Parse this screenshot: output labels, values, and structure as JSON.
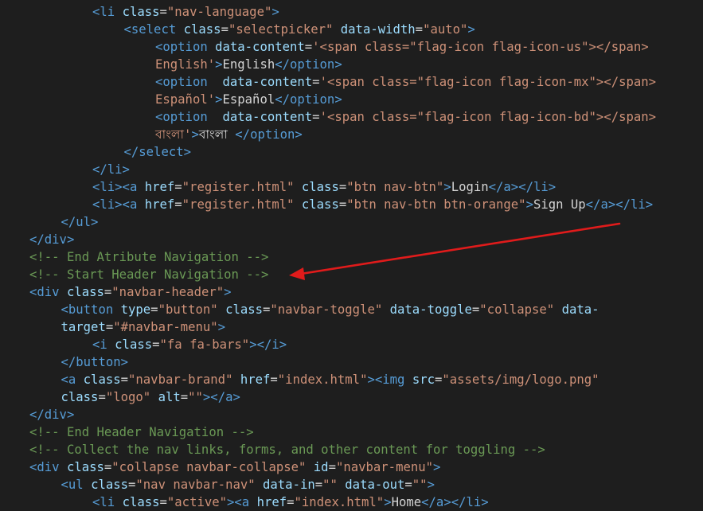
{
  "editor": {
    "lines": [
      {
        "indent": 2,
        "tokens": [
          {
            "t": "tag",
            "v": "<li "
          },
          {
            "t": "attr",
            "v": "class"
          },
          {
            "t": "txt",
            "v": "="
          },
          {
            "t": "str",
            "v": "\"nav-language\""
          },
          {
            "t": "tag",
            "v": ">"
          }
        ]
      },
      {
        "indent": 3,
        "tokens": [
          {
            "t": "tag",
            "v": "<select "
          },
          {
            "t": "attr",
            "v": "class"
          },
          {
            "t": "txt",
            "v": "="
          },
          {
            "t": "str",
            "v": "\"selectpicker\""
          },
          {
            "t": "txt",
            "v": " "
          },
          {
            "t": "attr",
            "v": "data-width"
          },
          {
            "t": "txt",
            "v": "="
          },
          {
            "t": "str",
            "v": "\"auto\""
          },
          {
            "t": "tag",
            "v": ">"
          }
        ]
      },
      {
        "indent": 4,
        "tokens": [
          {
            "t": "tag",
            "v": "<option "
          },
          {
            "t": "attr",
            "v": "data-content"
          },
          {
            "t": "txt",
            "v": "="
          },
          {
            "t": "str",
            "v": "'<span class=\"flag-icon flag-icon-us\"></span>"
          }
        ]
      },
      {
        "indent": 4,
        "tokens": [
          {
            "t": "str",
            "v": "English'"
          },
          {
            "t": "tag",
            "v": ">"
          },
          {
            "t": "txt",
            "v": "English"
          },
          {
            "t": "tag",
            "v": "</option>"
          }
        ]
      },
      {
        "indent": 4,
        "tokens": [
          {
            "t": "tag",
            "v": "<option "
          },
          {
            "t": "txt",
            "v": " "
          },
          {
            "t": "attr",
            "v": "data-content"
          },
          {
            "t": "txt",
            "v": "="
          },
          {
            "t": "str",
            "v": "'<span class=\"flag-icon flag-icon-mx\"></span>"
          }
        ]
      },
      {
        "indent": 4,
        "tokens": [
          {
            "t": "str",
            "v": "Español'"
          },
          {
            "t": "tag",
            "v": ">"
          },
          {
            "t": "txt",
            "v": "Español"
          },
          {
            "t": "tag",
            "v": "</option>"
          }
        ]
      },
      {
        "indent": 4,
        "tokens": [
          {
            "t": "tag",
            "v": "<option "
          },
          {
            "t": "txt",
            "v": " "
          },
          {
            "t": "attr",
            "v": "data-content"
          },
          {
            "t": "txt",
            "v": "="
          },
          {
            "t": "str",
            "v": "'<span class=\"flag-icon flag-icon-bd\"></span>"
          }
        ]
      },
      {
        "indent": 4,
        "tokens": [
          {
            "t": "str",
            "v": "বাংলা'"
          },
          {
            "t": "tag",
            "v": ">"
          },
          {
            "t": "txt",
            "v": "বাংলা "
          },
          {
            "t": "tag",
            "v": "</option>"
          }
        ]
      },
      {
        "indent": 3,
        "tokens": [
          {
            "t": "tag",
            "v": "</select>"
          }
        ]
      },
      {
        "indent": 2,
        "tokens": [
          {
            "t": "tag",
            "v": "</li>"
          }
        ]
      },
      {
        "indent": 2,
        "tokens": [
          {
            "t": "tag",
            "v": "<li><a "
          },
          {
            "t": "attr",
            "v": "href"
          },
          {
            "t": "txt",
            "v": "="
          },
          {
            "t": "str",
            "v": "\"register.html\""
          },
          {
            "t": "txt",
            "v": " "
          },
          {
            "t": "attr",
            "v": "class"
          },
          {
            "t": "txt",
            "v": "="
          },
          {
            "t": "str",
            "v": "\"btn nav-btn\""
          },
          {
            "t": "tag",
            "v": ">"
          },
          {
            "t": "txt",
            "v": "Login"
          },
          {
            "t": "tag",
            "v": "</a></li>"
          }
        ]
      },
      {
        "indent": 2,
        "tokens": [
          {
            "t": "tag",
            "v": "<li><a "
          },
          {
            "t": "attr",
            "v": "href"
          },
          {
            "t": "txt",
            "v": "="
          },
          {
            "t": "str",
            "v": "\"register.html\""
          },
          {
            "t": "txt",
            "v": " "
          },
          {
            "t": "attr",
            "v": "class"
          },
          {
            "t": "txt",
            "v": "="
          },
          {
            "t": "str",
            "v": "\"btn nav-btn btn-orange\""
          },
          {
            "t": "tag",
            "v": ">"
          },
          {
            "t": "txt",
            "v": "Sign Up"
          },
          {
            "t": "tag",
            "v": "</a></li>"
          }
        ]
      },
      {
        "indent": 1,
        "tokens": [
          {
            "t": "tag",
            "v": "</ul>"
          }
        ]
      },
      {
        "indent": 0,
        "tokens": [
          {
            "t": "tag",
            "v": "</div>"
          }
        ]
      },
      {
        "indent": 0,
        "tokens": [
          {
            "t": "cmt",
            "v": "<!-- End Atribute Navigation -->"
          }
        ]
      },
      {
        "indent": 0,
        "tokens": [
          {
            "t": "cmt",
            "v": "<!-- Start Header Navigation -->"
          }
        ]
      },
      {
        "indent": 0,
        "tokens": [
          {
            "t": "tag",
            "v": "<div "
          },
          {
            "t": "attr",
            "v": "class"
          },
          {
            "t": "txt",
            "v": "="
          },
          {
            "t": "str",
            "v": "\"navbar-header\""
          },
          {
            "t": "tag",
            "v": ">"
          }
        ]
      },
      {
        "indent": 1,
        "tokens": [
          {
            "t": "tag",
            "v": "<button "
          },
          {
            "t": "attr",
            "v": "type"
          },
          {
            "t": "txt",
            "v": "="
          },
          {
            "t": "str",
            "v": "\"button\""
          },
          {
            "t": "txt",
            "v": " "
          },
          {
            "t": "attr",
            "v": "class"
          },
          {
            "t": "txt",
            "v": "="
          },
          {
            "t": "str",
            "v": "\"navbar-toggle\""
          },
          {
            "t": "txt",
            "v": " "
          },
          {
            "t": "attr",
            "v": "data-toggle"
          },
          {
            "t": "txt",
            "v": "="
          },
          {
            "t": "str",
            "v": "\"collapse\""
          },
          {
            "t": "txt",
            "v": " "
          },
          {
            "t": "attr",
            "v": "data-"
          }
        ]
      },
      {
        "indent": 1,
        "tokens": [
          {
            "t": "attr",
            "v": "target"
          },
          {
            "t": "txt",
            "v": "="
          },
          {
            "t": "str",
            "v": "\"#navbar-menu\""
          },
          {
            "t": "tag",
            "v": ">"
          }
        ]
      },
      {
        "indent": 2,
        "tokens": [
          {
            "t": "tag",
            "v": "<i "
          },
          {
            "t": "attr",
            "v": "class"
          },
          {
            "t": "txt",
            "v": "="
          },
          {
            "t": "str",
            "v": "\"fa fa-bars\""
          },
          {
            "t": "tag",
            "v": "></i>"
          }
        ]
      },
      {
        "indent": 1,
        "tokens": [
          {
            "t": "tag",
            "v": "</button>"
          }
        ]
      },
      {
        "indent": 1,
        "tokens": [
          {
            "t": "tag",
            "v": "<a "
          },
          {
            "t": "attr",
            "v": "class"
          },
          {
            "t": "txt",
            "v": "="
          },
          {
            "t": "str",
            "v": "\"navbar-brand\""
          },
          {
            "t": "txt",
            "v": " "
          },
          {
            "t": "attr",
            "v": "href"
          },
          {
            "t": "txt",
            "v": "="
          },
          {
            "t": "str",
            "v": "\"index.html\""
          },
          {
            "t": "tag",
            "v": "><img "
          },
          {
            "t": "attr",
            "v": "src"
          },
          {
            "t": "txt",
            "v": "="
          },
          {
            "t": "str",
            "v": "\"assets/img/logo.png\""
          }
        ]
      },
      {
        "indent": 1,
        "tokens": [
          {
            "t": "attr",
            "v": "class"
          },
          {
            "t": "txt",
            "v": "="
          },
          {
            "t": "str",
            "v": "\"logo\""
          },
          {
            "t": "txt",
            "v": " "
          },
          {
            "t": "attr",
            "v": "alt"
          },
          {
            "t": "txt",
            "v": "="
          },
          {
            "t": "str",
            "v": "\"\""
          },
          {
            "t": "tag",
            "v": "></a>"
          }
        ]
      },
      {
        "indent": 0,
        "tokens": [
          {
            "t": "tag",
            "v": "</div>"
          }
        ]
      },
      {
        "indent": 0,
        "tokens": [
          {
            "t": "cmt",
            "v": "<!-- End Header Navigation -->"
          }
        ]
      },
      {
        "indent": 0,
        "tokens": [
          {
            "t": "cmt",
            "v": "<!-- Collect the nav links, forms, and other content for toggling -->"
          }
        ]
      },
      {
        "indent": 0,
        "tokens": [
          {
            "t": "tag",
            "v": "<div "
          },
          {
            "t": "attr",
            "v": "class"
          },
          {
            "t": "txt",
            "v": "="
          },
          {
            "t": "str",
            "v": "\"collapse navbar-collapse\""
          },
          {
            "t": "txt",
            "v": " "
          },
          {
            "t": "attr",
            "v": "id"
          },
          {
            "t": "txt",
            "v": "="
          },
          {
            "t": "str",
            "v": "\"navbar-menu\""
          },
          {
            "t": "tag",
            "v": ">"
          }
        ]
      },
      {
        "indent": 1,
        "tokens": [
          {
            "t": "tag",
            "v": "<ul "
          },
          {
            "t": "attr",
            "v": "class"
          },
          {
            "t": "txt",
            "v": "="
          },
          {
            "t": "str",
            "v": "\"nav navbar-nav\""
          },
          {
            "t": "txt",
            "v": " "
          },
          {
            "t": "attr",
            "v": "data-in"
          },
          {
            "t": "txt",
            "v": "="
          },
          {
            "t": "str",
            "v": "\"\""
          },
          {
            "t": "txt",
            "v": " "
          },
          {
            "t": "attr",
            "v": "data-out"
          },
          {
            "t": "txt",
            "v": "="
          },
          {
            "t": "str",
            "v": "\"\""
          },
          {
            "t": "tag",
            "v": ">"
          }
        ]
      },
      {
        "indent": 2,
        "tokens": [
          {
            "t": "tag",
            "v": "<li "
          },
          {
            "t": "attr",
            "v": "class"
          },
          {
            "t": "txt",
            "v": "="
          },
          {
            "t": "str",
            "v": "\"active\""
          },
          {
            "t": "tag",
            "v": "><a "
          },
          {
            "t": "attr",
            "v": "href"
          },
          {
            "t": "txt",
            "v": "="
          },
          {
            "t": "str",
            "v": "\"index.html\""
          },
          {
            "t": "tag",
            "v": ">"
          },
          {
            "t": "txt",
            "v": "Home"
          },
          {
            "t": "tag",
            "v": "</a></li>"
          }
        ]
      }
    ]
  },
  "colors": {
    "background": "#1e1e1e",
    "tag": "#569cd6",
    "attribute": "#9cdcfe",
    "string": "#ce9178",
    "text": "#d4d4d4",
    "comment": "#6a9955",
    "annotation_arrow": "#e01b1b"
  },
  "annotation": {
    "icon": "red-arrow-icon",
    "points_to_line": 15
  }
}
